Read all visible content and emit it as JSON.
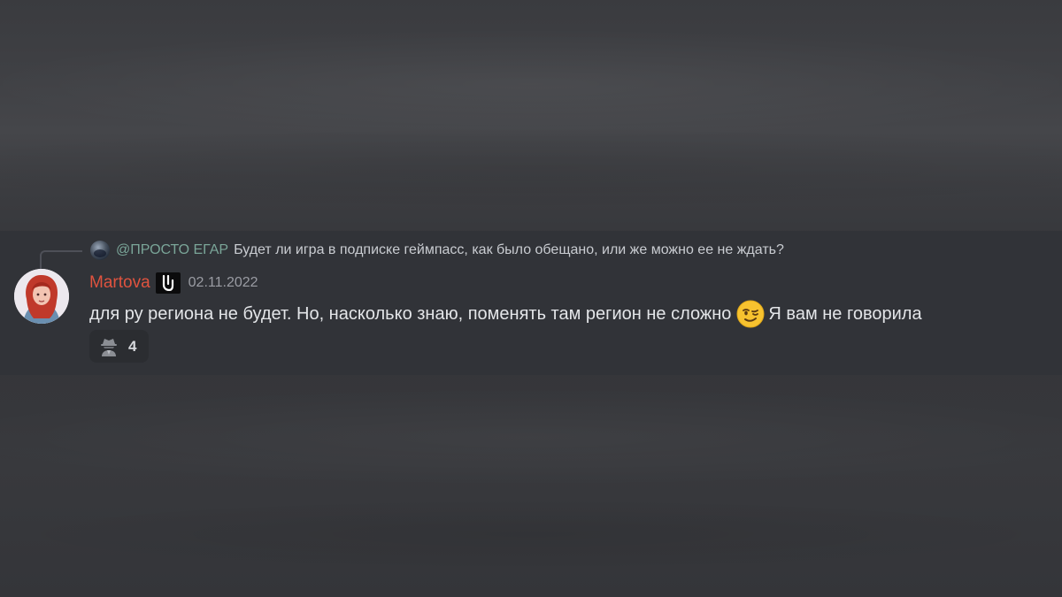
{
  "reply": {
    "mention": "@ПРОСТО ЕГАР",
    "text": "Будет ли игра в подписке геймпасс, как было обещано, или же можно ее не ждать?"
  },
  "message": {
    "author": "Martova",
    "badge_icon": "vgtimes-logo-icon",
    "timestamp": "02.11.2022",
    "text_before_emoji": "для ру региона не будет. Но, насколько знаю, поменять там регион не сложно",
    "emoji": "winking-face-icon",
    "text_after_emoji": "Я вам не говорила"
  },
  "reaction": {
    "icon": "spy-icon",
    "count": "4"
  },
  "colors": {
    "author_name": "#e0533f",
    "mention": "#7aa598",
    "message_bg": "#313338",
    "reaction_bg": "#2b2d31"
  }
}
